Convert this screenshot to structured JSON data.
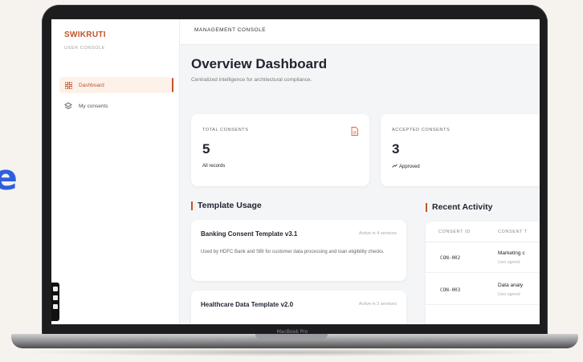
{
  "background": {
    "letter": "e"
  },
  "device": {
    "chin_label": "MacBook Pro"
  },
  "app": {
    "brand": "SWIKRUTI",
    "brand_sub": "USER CONSOLE",
    "accent_color": "#c2532b"
  },
  "sidebar": {
    "items": [
      {
        "label": "Dashboard",
        "icon": "grid-icon",
        "active": true
      },
      {
        "label": "My consents",
        "icon": "layers-icon",
        "active": false
      }
    ]
  },
  "header": {
    "title": "MANAGEMENT CONSOLE"
  },
  "page": {
    "title": "Overview Dashboard",
    "subtitle": "Centralized intelligence for architectural compliance."
  },
  "stats": [
    {
      "label": "TOTAL CONSENTS",
      "value": "5",
      "foot": "All records",
      "icon": "document-icon"
    },
    {
      "label": "ACCEPTED CONSENTS",
      "value": "3",
      "foot": "Approved",
      "icon": "trend-up-icon"
    }
  ],
  "template_usage": {
    "title": "Template Usage",
    "items": [
      {
        "name": "Banking Consent Template v3.1",
        "badge": "Active in 4 services",
        "desc": "Used by HDFC Bank and SBI for customer data processing and loan eligibility checks."
      },
      {
        "name": "Healthcare Data Template v2.0",
        "badge": "Active in 2 services",
        "desc": ""
      }
    ]
  },
  "recent_activity": {
    "title": "Recent Activity",
    "columns": [
      "CONSENT ID",
      "CONSENT T"
    ],
    "rows": [
      {
        "id": "CON-002",
        "type": "Marketing c",
        "sub": "User agreed"
      },
      {
        "id": "CON-003",
        "type": "Data analy",
        "sub": "User agreed"
      }
    ]
  }
}
